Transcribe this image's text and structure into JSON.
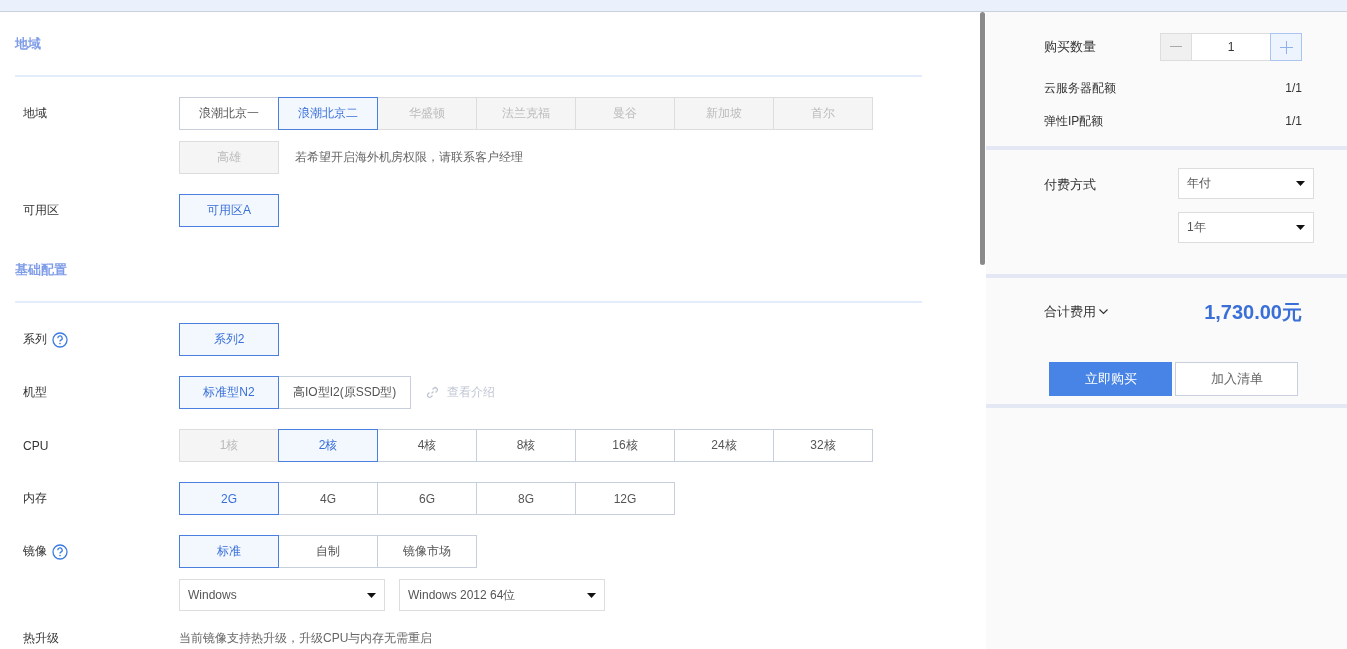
{
  "sections": [
    {
      "title": "地域",
      "rows": [
        {
          "kind": "options",
          "label": "地域",
          "help": false,
          "options": [
            {
              "label": "浪潮北京一",
              "selected": false,
              "disabled": false
            },
            {
              "label": "浪潮北京二",
              "selected": true,
              "disabled": false
            },
            {
              "label": "华盛顿",
              "selected": false,
              "disabled": true
            },
            {
              "label": "法兰克福",
              "selected": false,
              "disabled": true
            },
            {
              "label": "曼谷",
              "selected": false,
              "disabled": true
            },
            {
              "label": "新加坡",
              "selected": false,
              "disabled": true
            },
            {
              "label": "首尔",
              "selected": false,
              "disabled": true
            },
            {
              "label": "高雄",
              "selected": false,
              "disabled": true
            }
          ],
          "note": "若希望开启海外机房权限，请联系客户经理"
        },
        {
          "kind": "options",
          "label": "可用区",
          "help": false,
          "options": [
            {
              "label": "可用区A",
              "selected": true,
              "disabled": false
            }
          ]
        }
      ]
    },
    {
      "title": "基础配置",
      "rows": [
        {
          "kind": "options",
          "label": "系列",
          "help": true,
          "options": [
            {
              "label": "系列2",
              "selected": true,
              "disabled": false
            }
          ]
        },
        {
          "kind": "options",
          "label": "机型",
          "help": false,
          "options": [
            {
              "label": "标准型N2",
              "selected": true,
              "disabled": false
            },
            {
              "label": "高IO型I2(原SSD型)",
              "selected": false,
              "disabled": false
            }
          ],
          "link": "查看介绍"
        },
        {
          "kind": "options",
          "label": "CPU",
          "help": false,
          "options": [
            {
              "label": "1核",
              "selected": false,
              "disabled": true
            },
            {
              "label": "2核",
              "selected": true,
              "disabled": false
            },
            {
              "label": "4核",
              "selected": false,
              "disabled": false
            },
            {
              "label": "8核",
              "selected": false,
              "disabled": false
            },
            {
              "label": "16核",
              "selected": false,
              "disabled": false
            },
            {
              "label": "24核",
              "selected": false,
              "disabled": false
            },
            {
              "label": "32核",
              "selected": false,
              "disabled": false
            }
          ]
        },
        {
          "kind": "options",
          "label": "内存",
          "help": false,
          "options": [
            {
              "label": "2G",
              "selected": true,
              "disabled": false
            },
            {
              "label": "4G",
              "selected": false,
              "disabled": false
            },
            {
              "label": "6G",
              "selected": false,
              "disabled": false
            },
            {
              "label": "8G",
              "selected": false,
              "disabled": false
            },
            {
              "label": "12G",
              "selected": false,
              "disabled": false
            }
          ]
        },
        {
          "kind": "options",
          "label": "镜像",
          "help": true,
          "options": [
            {
              "label": "标准",
              "selected": true,
              "disabled": false
            },
            {
              "label": "自制",
              "selected": false,
              "disabled": false
            },
            {
              "label": "镜像市场",
              "selected": false,
              "disabled": false
            }
          ],
          "selects": [
            {
              "value": "Windows"
            },
            {
              "value": "Windows 2012 64位"
            }
          ]
        },
        {
          "kind": "text",
          "label": "热升级",
          "text": "当前镜像支持热升级，升级CPU与内存无需重启"
        }
      ]
    }
  ],
  "order": {
    "quantity": {
      "label": "购买数量",
      "value": "1",
      "decrement_disabled": true
    },
    "quotas": [
      {
        "label": "云服务器配额",
        "value": "1/1"
      },
      {
        "label": "弹性IP配额",
        "value": "1/1"
      }
    ],
    "payment": {
      "label": "付费方式",
      "selects": [
        {
          "value": "年付"
        },
        {
          "value": "1年"
        }
      ]
    },
    "total": {
      "label": "合计费用",
      "amount": "1,730.00元"
    },
    "buttons": [
      {
        "label": "立即购买",
        "kind": "primary"
      },
      {
        "label": "加入清单",
        "kind": "secondary"
      }
    ]
  }
}
